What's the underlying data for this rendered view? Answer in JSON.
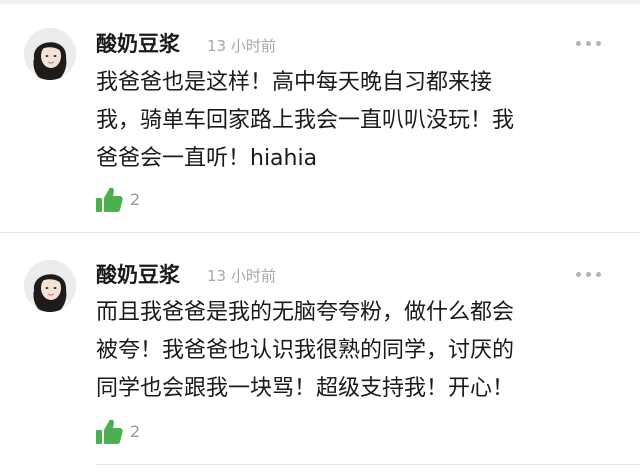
{
  "comments": [
    {
      "username": "酸奶豆浆",
      "time": "13 小时前",
      "lines": [
        "我爸爸也是这样！高中每天晚自习都来接",
        "我，骑单车回家路上我会一直叭叭没玩！我",
        "爸爸会一直听！hiahia"
      ],
      "likes": "2"
    },
    {
      "username": "酸奶豆浆",
      "time": "13 小时前",
      "lines": [
        "而且我爸爸是我的无脑夸夸粉，做什么都会",
        "被夸！我爸爸也认识我很熟的同学，讨厌的",
        "同学也会跟我一块骂！超级支持我！开心！"
      ],
      "likes": "2"
    }
  ],
  "colors": {
    "like_green": "#4caf50",
    "more_grey": "#b3b3b3"
  },
  "icons": [
    "avatar",
    "more-dots-icon",
    "thumbs-up-icon"
  ]
}
